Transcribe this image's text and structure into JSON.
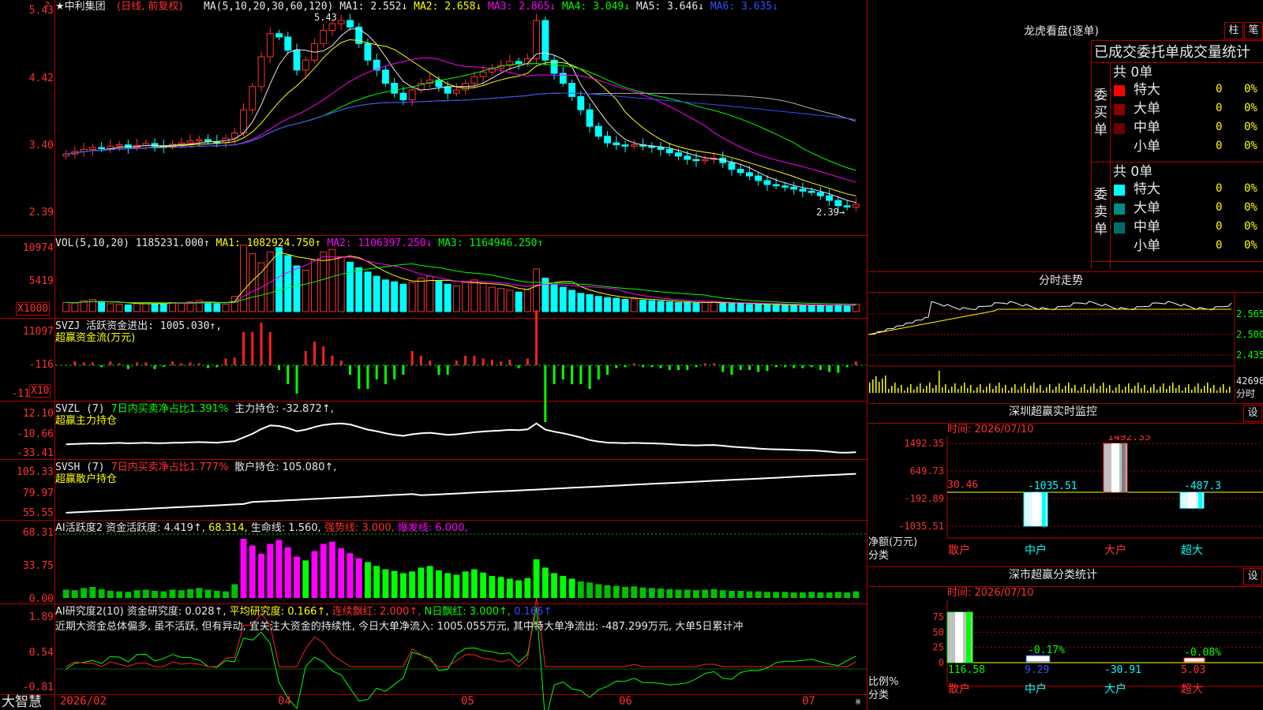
{
  "stock": {
    "title": "★中利集团",
    "subtitle": "(日线, 前复权)"
  },
  "main_panel": {
    "ma_header": {
      "ma_label": "MA(5,10,20,30,60,120)",
      "items": [
        {
          "text": "MA1: 2.552↓",
          "color": "#e8e8e8"
        },
        {
          "text": "MA2: 2.658↓",
          "color": "#ffff00"
        },
        {
          "text": "MA3: 2.865↓",
          "color": "#ff00ff"
        },
        {
          "text": "MA4: 3.049↓",
          "color": "#00ff00"
        },
        {
          "text": "MA5: 3.646↓",
          "color": "#e8e8e8"
        },
        {
          "text": "MA6: 3.635↓",
          "color": "#3050ff"
        }
      ]
    },
    "y_ticks": [
      "5.43",
      "4.42",
      "3.40",
      "2.39"
    ],
    "high_label": "5.43",
    "low_label": "2.39→"
  },
  "vol_panel": {
    "label": "VOL(5,10,20)",
    "value": "1185231.000↑",
    "ma1": "MA1: 1082924.750↑",
    "ma2": "MA2: 1106397.250↓",
    "ma3": "MA3: 1164946.250↑",
    "y_ticks": [
      "10974",
      "5419"
    ],
    "unit": "X1000"
  },
  "svzj_panel": {
    "line1": "SVZJ  活跃资金进出: 1005.030↑,",
    "line2": "超赢资金流(万元)",
    "y_ticks": [
      "11097",
      "-116",
      "-11"
    ],
    "unit": "X10"
  },
  "svzl_panel": {
    "label": "SVZL (7)",
    "text1": "7日内买卖净占比1.391%",
    "text2": "主力持仓: -32.872↑,",
    "line2": "超赢主力持仓",
    "y_ticks": [
      "12.10",
      "-10.66",
      "-33.41"
    ]
  },
  "svsh_panel": {
    "label": "SVSH (7)",
    "text1": "7日内买卖净占比1.777%",
    "text2": "散户持仓: 105.080↑,",
    "line2": "超赢散户持仓",
    "y_ticks": [
      "105.33",
      "79.97",
      "55.55"
    ]
  },
  "ai_active_panel": {
    "label": "AI活跃度2 资金活跃度: 4.419↑,",
    "v1": "68.314,",
    "v2": "生命线: 1.560,",
    "v3": "强势线: 3.000,",
    "v4": "爆发线: 6.000,",
    "y_ticks": [
      "68.31",
      "33.75",
      "0.00"
    ]
  },
  "ai_research_panel": {
    "label": "AI研究度2(10) 资金研究度: 0.028↑,",
    "v1": "平均研究度: 0.166↑,",
    "v2": "连续飘红: 2.000↑,",
    "v3": "N日飘红: 3.000↑,",
    "v4": "0.166↑",
    "comment": "近期大资金总体偏多, 虽不活跃, 但有异动, 宜关注大资金的持续性, 今日大单净流入: 1005.055万元, 其中特大单净流出: -487.299万元, 大单5日累计冲",
    "y_ticks": [
      "1.89",
      "0.54",
      "-0.81"
    ]
  },
  "x_axis": {
    "labels": [
      "2026/02",
      "04",
      "05",
      "06",
      "07"
    ]
  },
  "brand": "大智慧",
  "right_panel": {
    "longhu_title": "龙虎看盘(逐单)",
    "btn_zhu": "柱",
    "btn_bi": "笔",
    "order_title": "已成交委托单成交量统计",
    "buy": {
      "side_label": "委买单",
      "total": "共 0单",
      "rows": [
        {
          "name": "特大",
          "count": "0",
          "pct": "0%",
          "color": "#ff0000"
        },
        {
          "name": "大单",
          "count": "0",
          "pct": "0%",
          "color": "#8b0000"
        },
        {
          "name": "中单",
          "count": "0",
          "pct": "0%",
          "color": "#6b0000"
        },
        {
          "name": "小单",
          "count": "0",
          "pct": "0%",
          "color": "#000000"
        }
      ]
    },
    "sell": {
      "side_label": "委卖单",
      "total": "共 0单",
      "rows": [
        {
          "name": "特大",
          "count": "0",
          "pct": "0%",
          "color": "#00ffff"
        },
        {
          "name": "大单",
          "count": "0",
          "pct": "0%",
          "color": "#008b8b"
        },
        {
          "name": "中单",
          "count": "0",
          "pct": "0%",
          "color": "#006b6b"
        },
        {
          "name": "小单",
          "count": "0",
          "pct": "0%",
          "color": "#000000"
        }
      ]
    },
    "intraday": {
      "title": "分时走势",
      "ticks": [
        "2.565",
        "2.500",
        "2.435"
      ],
      "vol_tick": "42698",
      "vol_unit": "分时"
    },
    "sz_monitor": {
      "title": "深圳超赢实时监控",
      "btn": "设",
      "time": "时间: 2026/07/10",
      "y_ticks": [
        "1492.35",
        "649.73",
        "-192.89",
        "-1035.51"
      ],
      "ylabel": "净额(万元)",
      "xlabel": "分类",
      "categories": [
        "散户",
        "中户",
        "大户",
        "超大"
      ],
      "value_labels": [
        "30.46",
        "-1035.51",
        "1492.35",
        "-487.3"
      ]
    },
    "sh_stats": {
      "title": "深市超赢分类统计",
      "btn": "设",
      "time": "时间: 2026/07/10",
      "y_ticks": [
        "75",
        "50",
        "25",
        "0"
      ],
      "ylabel": "比例%",
      "xlabel": "分类",
      "categories": [
        "散户",
        "中户",
        "大户",
        "超大"
      ],
      "pct_labels": [
        "-0.17%",
        "-0.08%"
      ],
      "bottom_values": [
        "116.58",
        "9.29",
        "-30.91",
        "5.03"
      ]
    }
  },
  "chart_data": [
    {
      "type": "candlestick",
      "title": "中利集团 (日线, 前复权)",
      "y_range": [
        2.39,
        5.43
      ],
      "x_labels": [
        "2026/02",
        "04",
        "05",
        "06",
        "07"
      ],
      "close": [
        3.28,
        3.32,
        3.35,
        3.38,
        3.36,
        3.4,
        3.42,
        3.38,
        3.41,
        3.44,
        3.4,
        3.39,
        3.43,
        3.45,
        3.48,
        3.5,
        3.47,
        3.45,
        3.52,
        3.6,
        3.95,
        4.3,
        4.75,
        5.1,
        5.05,
        4.85,
        4.55,
        4.7,
        4.95,
        5.15,
        5.25,
        5.3,
        5.2,
        4.95,
        4.7,
        4.55,
        4.35,
        4.2,
        4.1,
        4.25,
        4.35,
        4.4,
        4.3,
        4.2,
        4.25,
        4.35,
        4.45,
        4.52,
        4.58,
        4.62,
        4.68,
        4.65,
        4.72,
        5.3,
        4.7,
        4.5,
        4.35,
        4.15,
        3.95,
        3.7,
        3.55,
        3.45,
        3.42,
        3.4,
        3.42,
        3.4,
        3.38,
        3.35,
        3.3,
        3.25,
        3.2,
        3.18,
        3.2,
        3.22,
        3.15,
        3.05,
        3.0,
        2.95,
        2.88,
        2.82,
        2.8,
        2.78,
        2.75,
        2.72,
        2.7,
        2.65,
        2.58,
        2.5,
        2.48,
        2.52
      ],
      "series": [
        {
          "name": "MA1",
          "values_note": "MA1: 2.552"
        },
        {
          "name": "MA2",
          "values_note": "MA2: 2.658"
        }
      ]
    },
    {
      "type": "bar",
      "title": "VOL(5,10,20)",
      "values": [
        1.5,
        1.4,
        1.8,
        2.0,
        1.6,
        1.3,
        1.2,
        1.1,
        1.4,
        1.5,
        1.3,
        1.2,
        1.5,
        1.4,
        1.6,
        1.8,
        1.5,
        1.3,
        1.2,
        2.5,
        10.9,
        9.5,
        8.0,
        9.8,
        10.5,
        9.2,
        7.5,
        6.8,
        8.5,
        9.8,
        10.2,
        9.0,
        8.1,
        7.2,
        6.5,
        5.8,
        5.2,
        4.9,
        4.5,
        4.8,
        5.5,
        5.8,
        5.0,
        4.5,
        4.2,
        4.8,
        5.2,
        4.6,
        4.0,
        3.8,
        3.5,
        3.2,
        3.6,
        7.0,
        5.5,
        4.5,
        4.0,
        3.5,
        3.0,
        2.8,
        2.5,
        2.3,
        2.2,
        2.0,
        2.1,
        1.9,
        1.8,
        1.7,
        1.6,
        1.5,
        1.5,
        1.4,
        1.5,
        1.6,
        1.4,
        1.3,
        1.3,
        1.2,
        1.2,
        1.1,
        1.1,
        1.1,
        1.0,
        1.0,
        1.1,
        1.0,
        1.0,
        1.1,
        1.0,
        1.2
      ],
      "ylim": [
        0,
        10974
      ]
    },
    {
      "type": "bar",
      "title": "深圳超赢实时监控",
      "categories": [
        "散户",
        "中户",
        "大户",
        "超大"
      ],
      "values": [
        30.46,
        -1035.51,
        1492.35,
        -487.3
      ],
      "ylim": [
        -1035.51,
        1492.35
      ]
    },
    {
      "type": "bar",
      "title": "深市超赢分类统计",
      "categories": [
        "散户",
        "中户",
        "大户",
        "超大"
      ],
      "values": [
        116.58,
        9.29,
        -30.91,
        5.03
      ],
      "ylim": [
        0,
        100
      ]
    }
  ]
}
